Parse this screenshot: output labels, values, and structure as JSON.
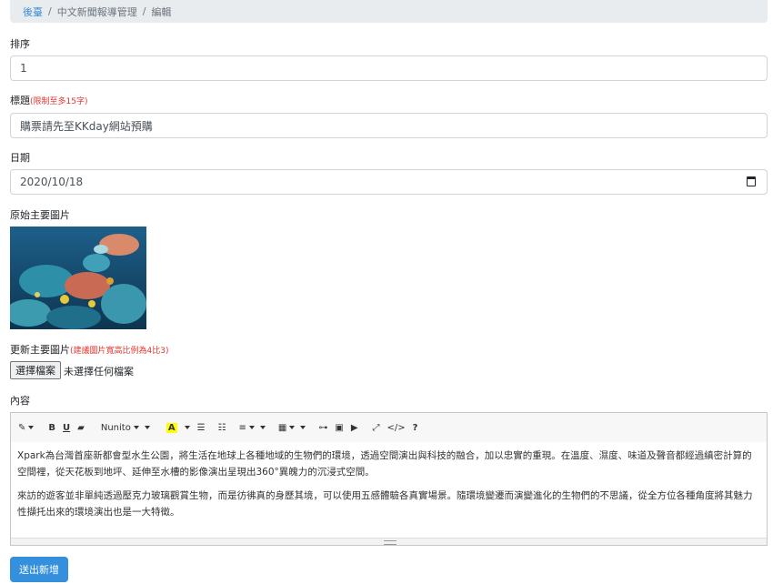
{
  "breadcrumb": {
    "home": "後臺",
    "section": "中文新聞報導管理",
    "current": "編輯"
  },
  "fields": {
    "order_label": "排序",
    "order_value": "1",
    "title_label": "標題",
    "title_hint": "(限制至多15字)",
    "title_value": "購票請先至KKday網站預購",
    "date_label": "日期",
    "date_value": "2020/10/18",
    "orig_image_label": "原始主要圖片",
    "update_image_label": "更新主要圖片",
    "update_image_hint": "(建議圖片寬高比例為4比3)",
    "file_button": "選擇檔案",
    "file_status": "未選擇任何檔案",
    "content_label": "內容"
  },
  "editor": {
    "font_name": "Nunito",
    "paragraphs": [
      "Xpark為台灣首座新都會型水生公園，將生活在地球上各種地域的生物們的環境，透過空間演出與科技的融合，加以忠實的重現。在溫度、濕度、味道及聲音都經過縝密計算的空間裡，從天花板到地坪、延伸至水槽的影像演出呈現出360°異魄力的沉浸式空間。",
      "來訪的遊客並非單純透過壓克力玻璃觀賞生物，而是彷彿真的身歷其境，可以使用五感體驗各真實場景。隨環境變遷而演變進化的生物們的不思議，從全方位各種角度將其魅力性擷托出來的環境演出也是一大特徵。"
    ]
  },
  "submit_label": "送出新增"
}
